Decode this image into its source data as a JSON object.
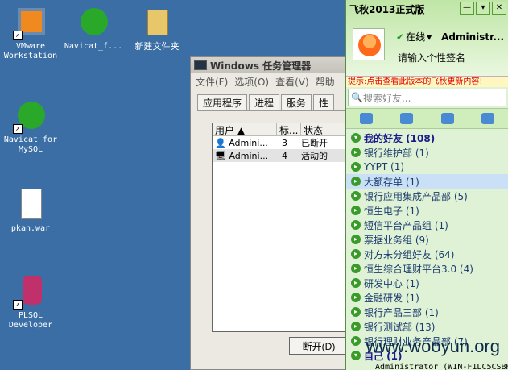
{
  "desktop": {
    "icons": [
      {
        "label": "VMware\nWorkstation"
      },
      {
        "label": "Navicat_f..."
      },
      {
        "label": "新建文件夹"
      },
      {
        "label": "Navicat for\nMySQL"
      },
      {
        "label": "pkan.war"
      },
      {
        "label": "PLSQL\nDeveloper"
      }
    ]
  },
  "taskmgr": {
    "title": "Windows 任务管理器",
    "menu": [
      "文件(F)",
      "选项(O)",
      "查看(V)",
      "帮助"
    ],
    "tabs": [
      "应用程序",
      "进程",
      "服务",
      "性"
    ],
    "columns": [
      "用户",
      "标...",
      "状态"
    ],
    "rows": [
      {
        "user": "Admini...",
        "id": "3",
        "status": "已断开"
      },
      {
        "user": "Admini...",
        "id": "4",
        "status": "活动的"
      }
    ],
    "disconnect_button": "断开(D)"
  },
  "feiq": {
    "title": "飞秋2013正式版",
    "status": "在线",
    "username": "Administr...",
    "signature": "请输入个性签名",
    "notice": "提示:点击查看此版本的飞秋更新内容!",
    "search_placeholder": "搜索好友...",
    "groups": [
      {
        "label": "我的好友 (108)"
      },
      {
        "label": "银行维护部 (1)"
      },
      {
        "label": "YYPT (1)"
      },
      {
        "label": "大额存单 (1)"
      },
      {
        "label": "银行应用集成产品部 (5)"
      },
      {
        "label": "恒生电子 (1)"
      },
      {
        "label": "短信平台产品组 (1)"
      },
      {
        "label": "票据业务组 (9)"
      },
      {
        "label": "对方未分组好友 (64)"
      },
      {
        "label": "恒生综合理财平台3.0 (4)"
      },
      {
        "label": "研发中心 (1)"
      },
      {
        "label": "金融研发 (1)"
      },
      {
        "label": "银行产品三部 (1)"
      },
      {
        "label": "银行测试部 (13)"
      },
      {
        "label": "银行理财业务产品部 (7)"
      },
      {
        "label": "自己 (1)"
      }
    ],
    "member": "Administrator (WIN-F1LC5CSBH"
  },
  "watermark": "www.wooyun.org"
}
